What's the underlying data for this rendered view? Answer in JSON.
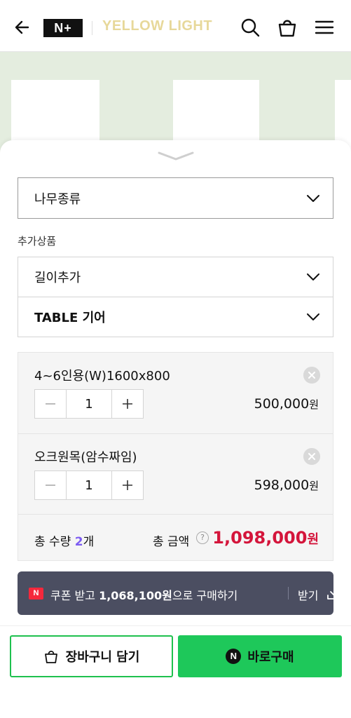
{
  "header": {
    "logo_text": "N+",
    "store_name": "YELLOW LIGHT"
  },
  "options": {
    "wood_type_label": "나무종류",
    "additional_section_title": "추가상품",
    "length_add_label": "길이추가",
    "table_gear_label": "TABLE 기어"
  },
  "selected_items": [
    {
      "name": "4~6인용(W)1600x800",
      "quantity": "1",
      "price": "500,000",
      "currency": "원"
    },
    {
      "name": "오크원목(암수짜임)",
      "quantity": "1",
      "price": "598,000",
      "currency": "원"
    }
  ],
  "totals": {
    "quantity_label": "총 수량",
    "quantity_value": "2",
    "quantity_unit": "개",
    "amount_label": "총 금액",
    "help_mark": "?",
    "amount_value": "1,098,000",
    "currency": "원"
  },
  "coupon": {
    "badge": "N",
    "text_prefix": "쿠폰 받고 ",
    "text_amount": "1,068,100원",
    "text_suffix": "으로 구매하기",
    "get_label": "받기"
  },
  "actions": {
    "add_to_cart": "장바구니 담기",
    "buy_now": "바로구매",
    "buy_badge": "N"
  },
  "colors": {
    "accent_green": "#1ec85a",
    "price_red": "#d4153b",
    "quantity_purple": "#7d5cf2",
    "coupon_bg": "#4b4e61"
  }
}
